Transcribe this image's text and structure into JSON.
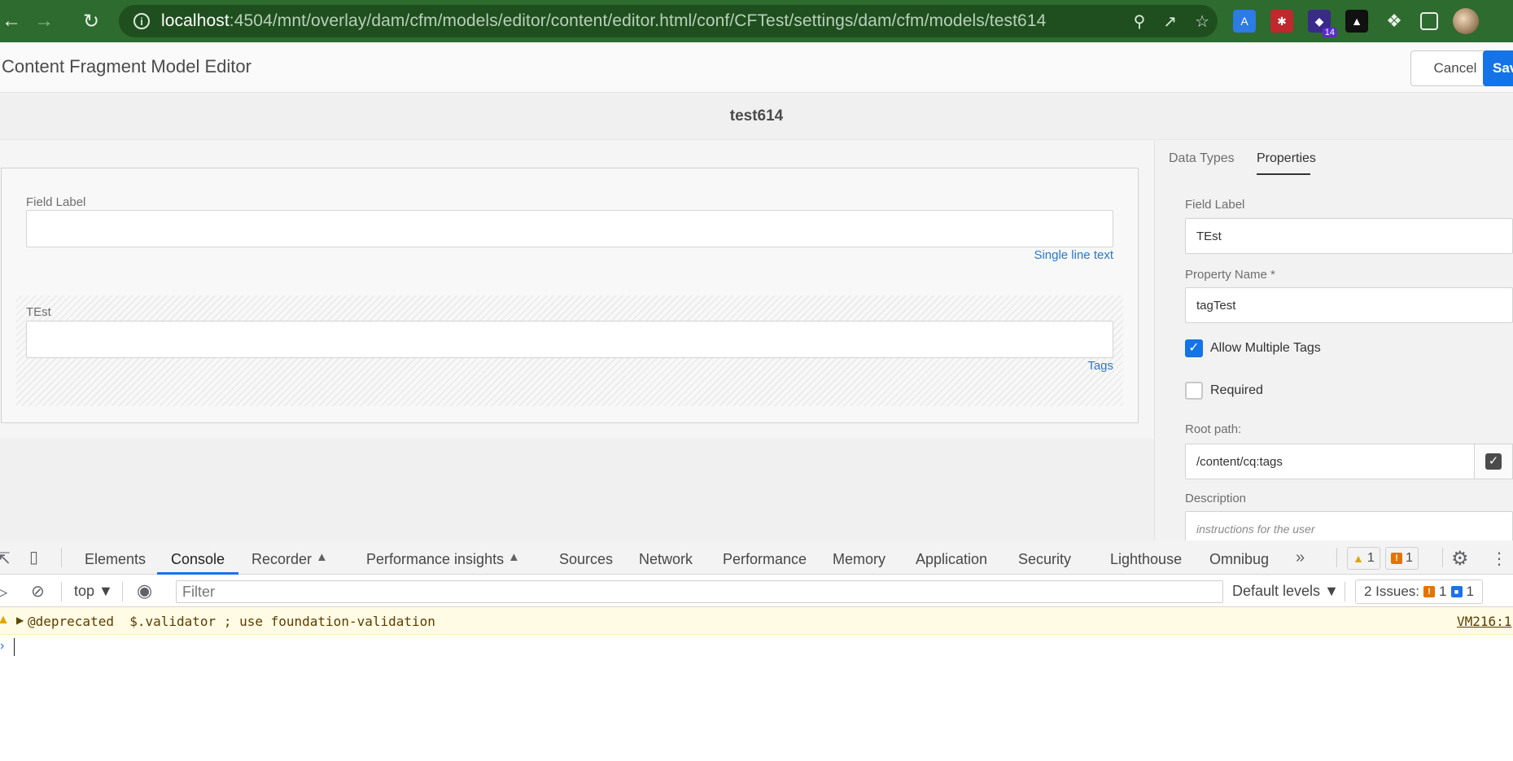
{
  "browser": {
    "url_host": "localhost",
    "url_path": ":4504/mnt/overlay/dam/cfm/models/editor/content/editor.html/conf/CFTest/settings/dam/cfm/models/test614",
    "extension_badge": "14"
  },
  "header": {
    "title": "Content Fragment Model Editor",
    "cancel_label": "Cancel",
    "save_label": "Save"
  },
  "model": {
    "name": "test614"
  },
  "canvas": {
    "fields": [
      {
        "label": "Field Label",
        "type": "Single line text"
      },
      {
        "label": "TEst",
        "type": "Tags"
      }
    ]
  },
  "panel": {
    "tabs": [
      "Data Types",
      "Properties"
    ],
    "active_tab": "Properties",
    "field_label_label": "Field Label",
    "field_label_value": "TEst",
    "property_name_label": "Property Name *",
    "property_name_value": "tagTest",
    "allow_multiple_label": "Allow Multiple Tags",
    "allow_multiple_checked": true,
    "required_label": "Required",
    "required_checked": false,
    "root_path_label": "Root path:",
    "root_path_value": "/content/cq:tags",
    "description_label": "Description",
    "description_placeholder": "instructions for the user"
  },
  "devtools": {
    "tabs": [
      "Elements",
      "Console",
      "Recorder",
      "Performance insights",
      "Sources",
      "Network",
      "Performance",
      "Memory",
      "Application",
      "Security",
      "Lighthouse",
      "Omnibug"
    ],
    "active_tab": "Console",
    "warnings_count": "1",
    "errors_count": "1",
    "context": "top",
    "filter_placeholder": "Filter",
    "levels": "Default levels",
    "issues_label": "2 Issues:",
    "issues_warn": "1",
    "issues_info": "1",
    "console_message": "@deprecated  $.validator ; use foundation-validation",
    "console_source": "VM216:1"
  },
  "colors": {
    "browser_bar": "#2e6b2e",
    "accent": "#1473e6",
    "link": "#2c76c9"
  }
}
